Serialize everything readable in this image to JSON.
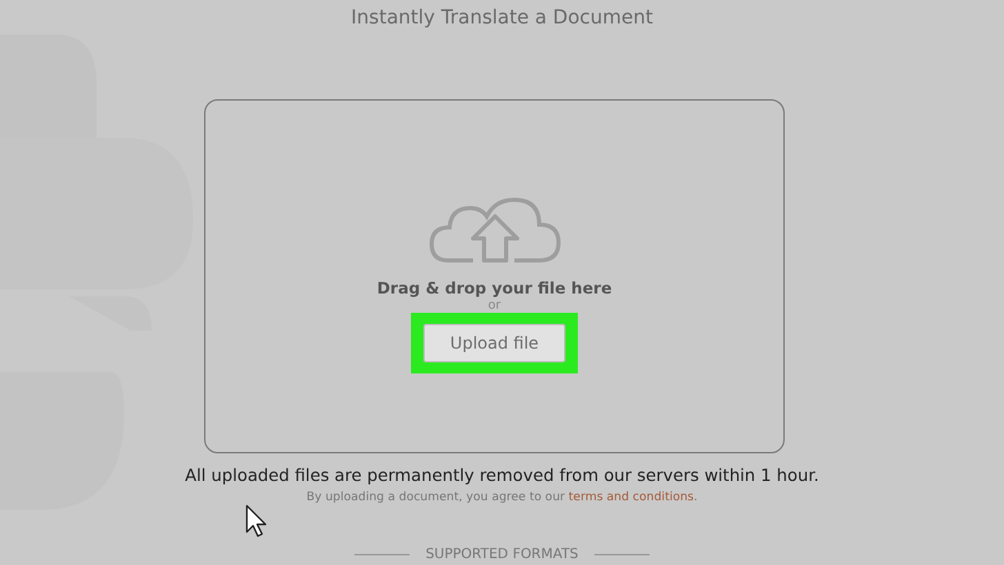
{
  "page": {
    "title": "Instantly Translate a Document"
  },
  "dropzone": {
    "prompt": "Drag & drop your file here",
    "separator": "or",
    "button": {
      "label": "Upload file",
      "highlighted": true
    }
  },
  "notice": "All uploaded files are permanently removed from our servers within 1 hour.",
  "agreement": {
    "text": "By uploading a document, you agree to our ",
    "link": "terms and conditions",
    "end": "."
  },
  "section_heading": "SUPPORTED FORMATS"
}
